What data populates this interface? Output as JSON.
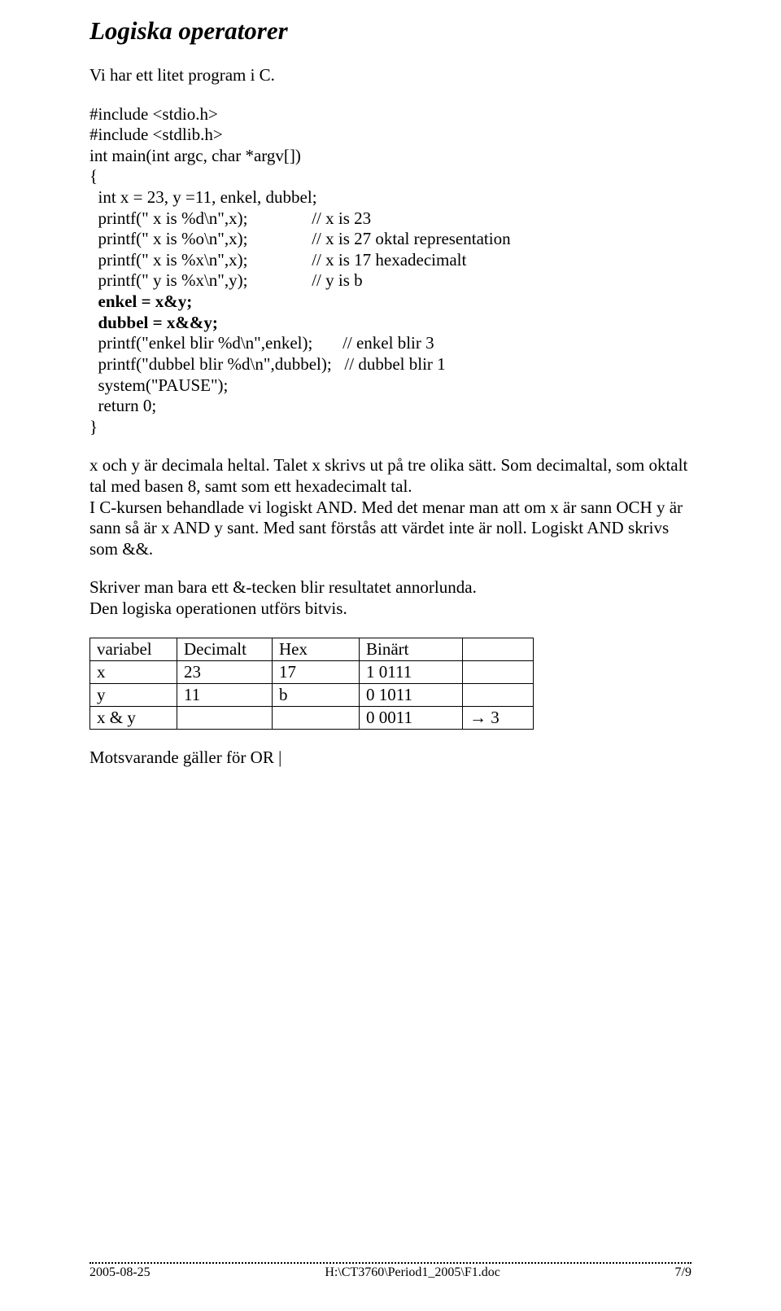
{
  "title": "Logiska operatorer",
  "intro": "Vi har ett litet program i C.",
  "code": {
    "l01": "#include <stdio.h>",
    "l02": "#include <stdlib.h>",
    "l03": "",
    "l04": "int main(int argc, char *argv[])",
    "l05": "{",
    "l06": "  int x = 23, y =11, enkel, dubbel;",
    "l07a": "  printf(\" x is %d\\n\",x);",
    "l07b": "// x is 23",
    "l08a": "  printf(\" x is %o\\n\",x);",
    "l08b": "// x is 27 oktal representation",
    "l09a": "  printf(\" x is %x\\n\",x);",
    "l09b": "// x is 17 hexadecimalt",
    "l10a": "  printf(\" y is %x\\n\",y);",
    "l10b": "// y is b",
    "l11": "  enkel = x&y;",
    "l12": "  dubbel = x&&y;",
    "l13a": "  printf(\"enkel blir %d\\n\",enkel);",
    "l13b": "// enkel blir 3",
    "l14a": "  printf(\"dubbel blir %d\\n\",dubbel);",
    "l14b": "// dubbel blir 1",
    "l15": "",
    "l16": "  system(\"PAUSE\");",
    "l17": "  return 0;",
    "l18": "}"
  },
  "para1": "x och y är decimala heltal. Talet x skrivs ut på tre olika sätt. Som decimaltal, som oktalt tal med basen 8, samt som ett hexadecimalt tal.",
  "para2": "I C-kursen behandlade vi logiskt AND. Med det menar man att om x är sann OCH y är sann så är x AND y sant. Med sant förstås att värdet inte är noll. Logiskt AND skrivs som &&.",
  "para3": "Skriver man bara ett &-tecken blir resultatet annorlunda.",
  "para4": "Den logiska operationen utförs bitvis.",
  "table": {
    "header": [
      "variabel",
      "Decimalt",
      "Hex",
      "Binärt",
      ""
    ],
    "rows": [
      [
        "x",
        "23",
        "17",
        "1  0111",
        ""
      ],
      [
        "y",
        "11",
        "b",
        "0  1011",
        ""
      ],
      [
        "x & y",
        "",
        "",
        "0  0011",
        "→  3"
      ]
    ]
  },
  "closing": "Motsvarande gäller för OR  |",
  "footer": {
    "date": "2005-08-25",
    "path": "H:\\CT3760\\Period1_2005\\F1.doc",
    "page": "7/9"
  }
}
